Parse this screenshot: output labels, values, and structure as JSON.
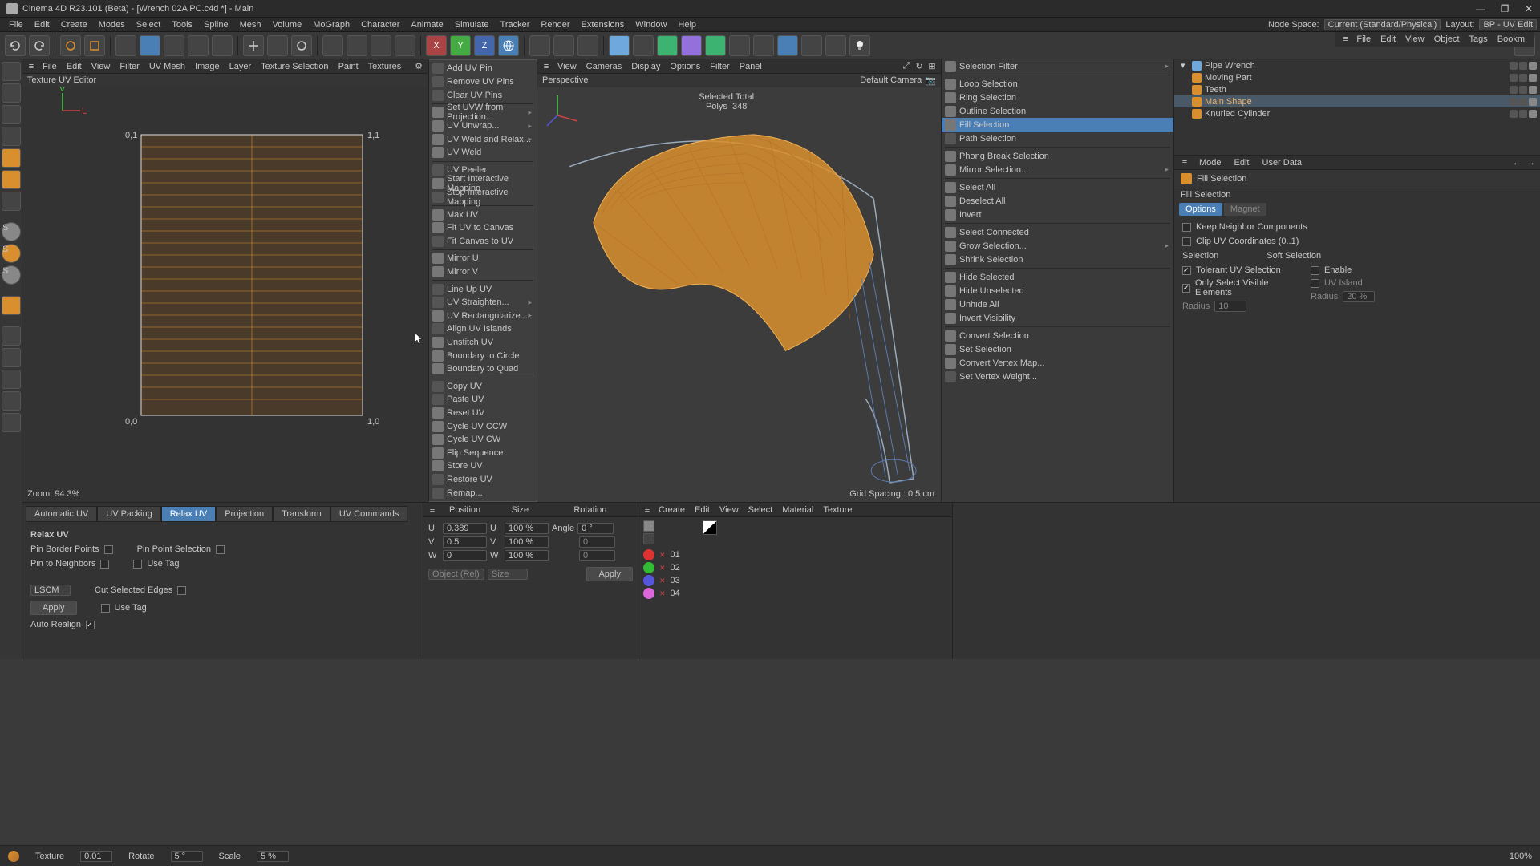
{
  "window": {
    "title": "Cinema 4D R23.101 (Beta) - [Wrench 02A PC.c4d *] - Main",
    "minimize": "—",
    "restore": "❐",
    "close": "✕"
  },
  "menubar": {
    "items": [
      "File",
      "Edit",
      "Create",
      "Modes",
      "Select",
      "Tools",
      "Spline",
      "Mesh",
      "Volume",
      "MoGraph",
      "Character",
      "Animate",
      "Simulate",
      "Tracker",
      "Render",
      "Extensions",
      "Window",
      "Help"
    ],
    "nodespace_label": "Node Space:",
    "nodespace_value": "Current (Standard/Physical)",
    "layout_label": "Layout:",
    "layout_value": "BP - UV Edit"
  },
  "left_strip": [
    "cursor",
    "live",
    "rect",
    "move",
    "rot",
    "scl",
    "cube",
    "poly",
    "edge",
    "axis",
    "snap",
    "s1",
    "s2",
    "s3",
    "paint",
    "grid1",
    "grid2",
    "diag",
    "sphere",
    "ring"
  ],
  "uv_panel": {
    "menus": [
      "File",
      "Edit",
      "View",
      "Filter",
      "UV Mesh",
      "Image",
      "Layer",
      "Texture Selection",
      "Paint",
      "Textures"
    ],
    "title": "Texture UV Editor",
    "labels": {
      "tl": "0,1",
      "tr": "1,1",
      "bl": "0,0",
      "br": "1,0"
    },
    "zoom": "Zoom: 94.3%"
  },
  "context_menu": {
    "items": [
      {
        "label": "Add UV Pin",
        "disabled": true
      },
      {
        "label": "Remove UV Pins",
        "disabled": true
      },
      {
        "label": "Clear UV Pins",
        "disabled": true
      },
      {
        "sep": true
      },
      {
        "label": "Set UVW from Projection...",
        "sub": true
      },
      {
        "label": "UV Unwrap...",
        "sub": true
      },
      {
        "label": "UV Weld and Relax...",
        "sub": true
      },
      {
        "label": "UV Weld"
      },
      {
        "sep": true
      },
      {
        "label": "UV Peeler",
        "disabled": true
      },
      {
        "label": "Start Interactive Mapping"
      },
      {
        "label": "Stop Interactive Mapping",
        "disabled": true
      },
      {
        "sep": true
      },
      {
        "label": "Max UV"
      },
      {
        "label": "Fit UV to Canvas"
      },
      {
        "label": "Fit Canvas to UV",
        "disabled": true
      },
      {
        "sep": true
      },
      {
        "label": "Mirror U"
      },
      {
        "label": "Mirror V"
      },
      {
        "sep": true
      },
      {
        "label": "Line Up UV",
        "disabled": true
      },
      {
        "label": "UV Straighten...",
        "disabled": true,
        "sub": true
      },
      {
        "label": "UV Rectangularize...",
        "sub": true
      },
      {
        "label": "Align UV Islands",
        "disabled": true
      },
      {
        "label": "Unstitch UV"
      },
      {
        "label": "Boundary to Circle"
      },
      {
        "label": "Boundary to Quad"
      },
      {
        "sep": true
      },
      {
        "label": "Copy UV",
        "disabled": true
      },
      {
        "label": "Paste UV",
        "disabled": true
      },
      {
        "label": "Reset UV"
      },
      {
        "label": "Cycle UV CCW"
      },
      {
        "label": "Cycle UV CW"
      },
      {
        "label": "Flip Sequence"
      },
      {
        "label": "Store UV"
      },
      {
        "label": "Restore UV",
        "disabled": true
      },
      {
        "label": "Remap...",
        "disabled": true
      }
    ]
  },
  "viewport": {
    "menus": [
      "View",
      "Cameras",
      "Display",
      "Options",
      "Filter",
      "Panel"
    ],
    "title": "Perspective",
    "camera": "Default Camera",
    "selected_title": "Selected Total",
    "polys_label": "Polys",
    "polys_value": "348",
    "grid": "Grid Spacing : 0.5 cm"
  },
  "selection_panel": {
    "items": [
      {
        "label": "Selection Filter",
        "sub": true
      },
      {
        "sep": true
      },
      {
        "label": "Loop Selection"
      },
      {
        "label": "Ring Selection"
      },
      {
        "label": "Outline Selection"
      },
      {
        "label": "Fill Selection",
        "hi": true
      },
      {
        "label": "Path Selection",
        "disabled": true
      },
      {
        "sep": true
      },
      {
        "label": "Phong Break Selection"
      },
      {
        "label": "Mirror Selection...",
        "sub": true
      },
      {
        "sep": true
      },
      {
        "label": "Select All"
      },
      {
        "label": "Deselect All"
      },
      {
        "label": "Invert"
      },
      {
        "sep": true
      },
      {
        "label": "Select Connected"
      },
      {
        "label": "Grow Selection...",
        "sub": true
      },
      {
        "label": "Shrink Selection"
      },
      {
        "sep": true
      },
      {
        "label": "Hide Selected"
      },
      {
        "label": "Hide Unselected"
      },
      {
        "label": "Unhide All"
      },
      {
        "label": "Invert Visibility"
      },
      {
        "sep": true
      },
      {
        "label": "Convert Selection"
      },
      {
        "label": "Set Selection"
      },
      {
        "label": "Convert Vertex Map..."
      },
      {
        "label": "Set Vertex Weight...",
        "disabled": true
      }
    ]
  },
  "object_tree": {
    "items": [
      {
        "label": "Pipe Wrench",
        "depth": 0,
        "sel": false,
        "ico": "#6fa8dc"
      },
      {
        "label": "Moving Part",
        "depth": 1,
        "sel": false,
        "ico": "#d98f2e"
      },
      {
        "label": "Teeth",
        "depth": 1,
        "sel": false,
        "ico": "#d98f2e"
      },
      {
        "label": "Main Shape",
        "depth": 1,
        "sel": true,
        "ico": "#d98f2e"
      },
      {
        "label": "Knurled Cylinder",
        "depth": 1,
        "sel": false,
        "ico": "#d98f2e"
      }
    ]
  },
  "attributes": {
    "menus": [
      "Mode",
      "Edit",
      "User Data"
    ],
    "title": "Fill Selection",
    "subtitle": "Fill Selection",
    "tabs": [
      "Options",
      "Magnet"
    ],
    "options": {
      "keep_neighbor": "Keep Neighbor Components",
      "clip_uv": "Clip UV Coordinates (0..1)",
      "selection_hdr": "Selection",
      "soft_hdr": "Soft Selection",
      "tolerant": "Tolerant UV Selection",
      "only_visible": "Only Select Visible Elements",
      "enable": "Enable",
      "uv_island": "UV Island",
      "radius_l": "Radius",
      "radius_l_val": "10",
      "radius_r": "Radius",
      "radius_r_val": "20 %"
    }
  },
  "bottom": {
    "tabs": [
      "Automatic UV",
      "UV Packing",
      "Relax UV",
      "Projection",
      "Transform",
      "UV Commands"
    ],
    "active_tab": 2,
    "relax": {
      "title": "Relax UV",
      "pin_border": "Pin Border Points",
      "pin_point": "Pin Point Selection",
      "pin_neighbors": "Pin to Neighbors",
      "use_tag1": "Use Tag",
      "algo": "LSCM",
      "cut_edges": "Cut Selected Edges",
      "use_tag2": "Use Tag",
      "apply": "Apply",
      "auto_realign": "Auto Realign"
    },
    "coords": {
      "hdr": {
        "pos": "Position",
        "size": "Size",
        "rot": "Rotation"
      },
      "u": "U",
      "u_val": "0.389",
      "uw": "100 %",
      "angle": "Angle",
      "angle_val": "0 °",
      "v": "V",
      "v_val": "0.5",
      "vw": "100 %",
      "vzero": "0",
      "w": "W",
      "w_val": "0",
      "ww": "100 %",
      "wzero": "0",
      "obj": "Object (Rel)",
      "size": "Size",
      "apply": "Apply"
    },
    "materials": {
      "menus": [
        "Create",
        "Edit",
        "View",
        "Select",
        "Material",
        "Texture"
      ],
      "rows": [
        {
          "c": "#d33",
          "label": "01"
        },
        {
          "c": "#3b3",
          "label": "02"
        },
        {
          "c": "#55d",
          "label": "03"
        },
        {
          "c": "#d6d",
          "label": "04"
        }
      ]
    }
  },
  "statusbar": {
    "texture": "Texture",
    "texture_val": "0.01",
    "rotate": "Rotate",
    "rotate_val": "5 °",
    "scale": "Scale",
    "scale_val": "5 %",
    "pct": "100%"
  }
}
